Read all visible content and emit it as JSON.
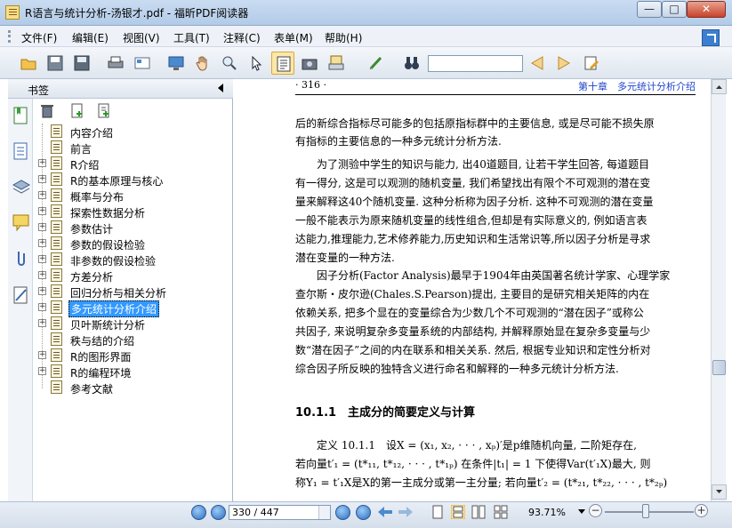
{
  "window": {
    "title": "R语言与统计分析-汤银才.pdf - 福昕PDF阅读器"
  },
  "menu": [
    {
      "label": "文件(F)"
    },
    {
      "label": "编辑(E)"
    },
    {
      "label": "视图(V)"
    },
    {
      "label": "工具(T)"
    },
    {
      "label": "注释(C)"
    },
    {
      "label": "表单(M)"
    },
    {
      "label": "帮助(H)"
    }
  ],
  "toolbar": {
    "icons": [
      "open-folder-icon",
      "save-icon",
      "save-all-icon",
      "print-icon",
      "properties-icon",
      "full-screen-icon",
      "hand-tool-icon",
      "zoom-tool-icon",
      "select-arrow-icon",
      "text-select-icon",
      "snapshot-icon",
      "rms-icon",
      "sign-icon",
      "binoculars-icon",
      "prev-find-icon",
      "next-find-icon",
      "highlight-pen-icon"
    ],
    "search_value": ""
  },
  "sidebar": {
    "title": "书签",
    "bookmarks": [
      {
        "label": "内容介绍",
        "expandable": false
      },
      {
        "label": "前言",
        "expandable": false
      },
      {
        "label": "R介绍",
        "expandable": true
      },
      {
        "label": "R的基本原理与核心",
        "expandable": true
      },
      {
        "label": "概率与分布",
        "expandable": true
      },
      {
        "label": "探索性数据分析",
        "expandable": true
      },
      {
        "label": "参数估计",
        "expandable": true
      },
      {
        "label": "参数的假设检验",
        "expandable": true
      },
      {
        "label": "非参数的假设检验",
        "expandable": true
      },
      {
        "label": "方差分析",
        "expandable": true
      },
      {
        "label": "回归分析与相关分析",
        "expandable": true
      },
      {
        "label": "多元统计分析介绍",
        "expandable": true,
        "selected": true
      },
      {
        "label": "贝叶斯统计分析",
        "expandable": true
      },
      {
        "label": "秩与结的介绍",
        "expandable": false
      },
      {
        "label": "R的图形界面",
        "expandable": true
      },
      {
        "label": "R的编程环境",
        "expandable": true
      },
      {
        "label": "参考文献",
        "expandable": false
      }
    ]
  },
  "document": {
    "page_number": "· 316 ·",
    "chapter_header": "第十章　多元统计分析介绍",
    "para1": [
      "后的新综合指标尽可能多的包括原指标群中的主要信息, 或是尽可能不损失原",
      "有指标的主要信息的一种多元统计分析方法."
    ],
    "para2": [
      "　　为了测验中学生的知识与能力, 出40道题目, 让若干学生回答, 每道题目",
      "有一得分, 这是可以观测的随机变量, 我们希望找出有限个不可观测的潜在变",
      "量来解释这40个随机变量. 这种分析称为因子分析. 这种不可观测的潜在变量",
      "一般不能表示为原来随机变量的线性组合,但却是有实际意义的, 例如语言表",
      "达能力,推理能力,艺术修养能力,历史知识和生活常识等,所以因子分析是寻求",
      "潜在变量的一种方法."
    ],
    "para3": [
      "　　因子分析(Factor Analysis)最早于1904年由英国著名统计学家、心理学家",
      "查尔斯・皮尔逊(Chales.S.Pearson)提出, 主要目的是研究相关矩阵的内在",
      "依赖关系, 把多个显在的变量综合为少数几个不可观测的“潜在因子”或称公",
      "共因子, 来说明复杂多变量系统的内部结构, 并解释原始显在复杂多变量与少",
      "数“潜在因子”之间的内在联系和相关关系. 然后, 根据专业知识和定性分析对",
      "综合因子所反映的独特含义进行命名和解释的一种多元统计分析方法."
    ],
    "section_heading": "10.1.1　主成分的简要定义与计算",
    "definition": [
      "　　定义 10.1.1　设X = (x₁, x₂, · · · , xₚ)′是p维随机向量, 二阶矩存在,",
      "若向量t′₁ = (t*₁₁, t*₁₂, · · · , t*₁ₚ) 在条件|t₁| = 1 下使得Var(t′₁X)最大, 则",
      "称Y₁ = t′₁X是X的第一主成分或第一主分量; 若向量t′₂ = (t*₂₁, t*₂₂, · · · , t*₂ₚ)"
    ]
  },
  "statusbar": {
    "page_field": "330 / 447",
    "zoom": "93.71%",
    "zoom_level_percent": 93.71
  }
}
